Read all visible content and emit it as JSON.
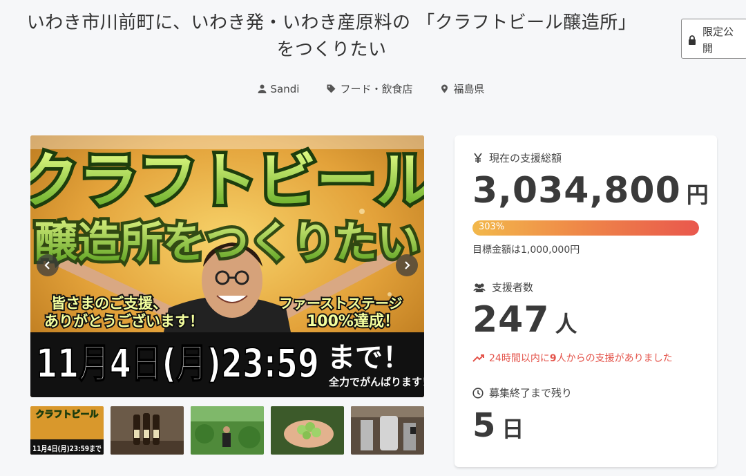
{
  "title": {
    "line1": "いわき市川前町に、いわき発・いわき産原料の 「クラフトビール醸造所」",
    "line2": "をつくりたい"
  },
  "badge": {
    "line1": "限定公",
    "line2": "開",
    "icon": "lock-icon"
  },
  "meta": {
    "author": {
      "icon": "user-icon",
      "label": "Sandi"
    },
    "category": {
      "icon": "tag-icon",
      "label": "フード・飲食店"
    },
    "location": {
      "icon": "pin-icon",
      "label": "福島県"
    }
  },
  "hero": {
    "headline1": "クラフトビール",
    "headline2": "醸造所をつくりたい",
    "thanks1": "皆さまのご支援、",
    "thanks2": "ありがとうございます！",
    "stage1": "ファーストステージ",
    "stage2": "100%達成！",
    "deadline": "11月4日(月)23:59",
    "until": "まで！",
    "effort": "全力でがんばります！",
    "prev_icon": "chevron-left-icon",
    "next_icon": "chevron-right-icon"
  },
  "thumbnails": [
    {
      "alt": "クラフトビール 醸造所をつくりたい 11月4日(月)23:59まで！",
      "caption1": "クラフトビール",
      "caption2": "11月4日(月)23:59まで"
    },
    {
      "alt": "ビール瓶"
    },
    {
      "alt": "畑の男性"
    },
    {
      "alt": "ホップ"
    },
    {
      "alt": "醸造設備"
    }
  ],
  "stats": {
    "total": {
      "icon": "yen-icon",
      "label": "現在の支援総額",
      "value": "3,034,800",
      "unit": "円",
      "percent_label": "303%",
      "progress": 1.0,
      "goal": "目標金額は1,000,000円"
    },
    "backers": {
      "icon": "users-icon",
      "label": "支援者数",
      "value": "247",
      "unit": "人",
      "recent_prefix": "24時間以内に",
      "recent_count": "9",
      "recent_suffix": "人からの支援がありました",
      "recent_icon": "trending-up-icon"
    },
    "remaining": {
      "icon": "clock-icon",
      "label": "募集終了まで残り",
      "value": "5",
      "unit": "日"
    }
  },
  "colors": {
    "accent_red": "#e4544b",
    "progress_start": "#f2b84b",
    "progress_end": "#e9574d",
    "headline_green": "#8fcf2a"
  }
}
